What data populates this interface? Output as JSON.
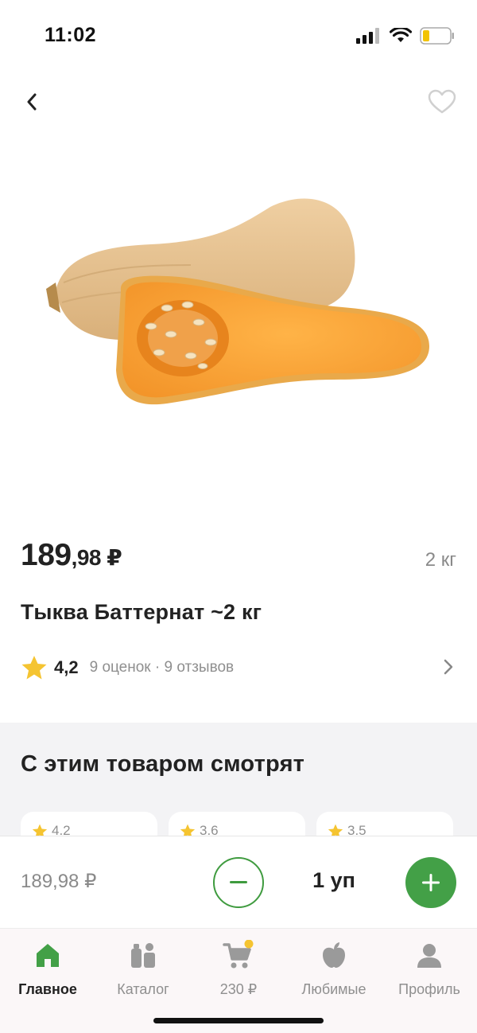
{
  "status_bar": {
    "time": "11:02",
    "icons": [
      "signal-icon",
      "wifi-icon",
      "battery-icon"
    ]
  },
  "header": {
    "back_icon": "chevron-left-icon",
    "favorite_icon": "heart-outline-icon"
  },
  "product": {
    "price_rub": "189",
    "price_kop": ",98 ₽",
    "weight": "2 кг",
    "title": "Тыква Баттернат ~2 кг",
    "image": "butternut-squash-photo",
    "rating": "4,2",
    "rating_meta": "9 оценок · 9 отзывов"
  },
  "related": {
    "title": "С этим товаром смотрят",
    "cards": [
      {
        "rating": "4.2"
      },
      {
        "rating": "3.6"
      },
      {
        "rating": "3.5"
      }
    ]
  },
  "cart_bar": {
    "price": "189,98 ₽",
    "quantity": "1 уп"
  },
  "tab_bar": {
    "tabs": [
      {
        "label": "Главное",
        "icon": "home-icon",
        "active": true
      },
      {
        "label": "Каталог",
        "icon": "catalog-icon",
        "active": false
      },
      {
        "label": "230 ₽",
        "icon": "cart-icon",
        "active": false
      },
      {
        "label": "Любимые",
        "icon": "apple-icon",
        "active": false
      },
      {
        "label": "Профиль",
        "icon": "profile-icon",
        "active": false
      }
    ]
  },
  "colors": {
    "accent_green": "#43a047",
    "star_yellow": "#f5c431",
    "muted_text": "#8f8f8f",
    "section_bg": "#f3f3f5"
  }
}
